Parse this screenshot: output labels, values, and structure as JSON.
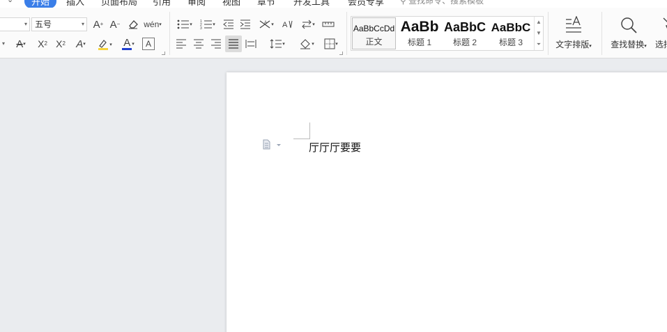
{
  "menu": {
    "tabs": [
      {
        "label": "开始",
        "active": true
      },
      {
        "label": "插入"
      },
      {
        "label": "页面布局"
      },
      {
        "label": "引用"
      },
      {
        "label": "审阅"
      },
      {
        "label": "视图"
      },
      {
        "label": "章节"
      },
      {
        "label": "开发工具"
      },
      {
        "label": "会员专享"
      }
    ],
    "search_placeholder": "查找命令、搜索模板"
  },
  "font": {
    "name_value": "",
    "size_value": "五号"
  },
  "styles": {
    "items": [
      {
        "preview": "AaBbCcDd",
        "label": "正文",
        "selected": true
      },
      {
        "preview": "AaBb",
        "label": "标题 1"
      },
      {
        "preview": "AaBbC",
        "label": "标题 2"
      },
      {
        "preview": "AaBbC",
        "label": "标题 3"
      }
    ]
  },
  "tools": {
    "text_layout": "文字排版",
    "find_replace": "查找替换",
    "select": "选择"
  },
  "document": {
    "text": "厅厅厅要要"
  },
  "colors": {
    "accent": "#3a7ee8",
    "highlight": "#f6d33b",
    "font_color": "#1f3fcf"
  }
}
